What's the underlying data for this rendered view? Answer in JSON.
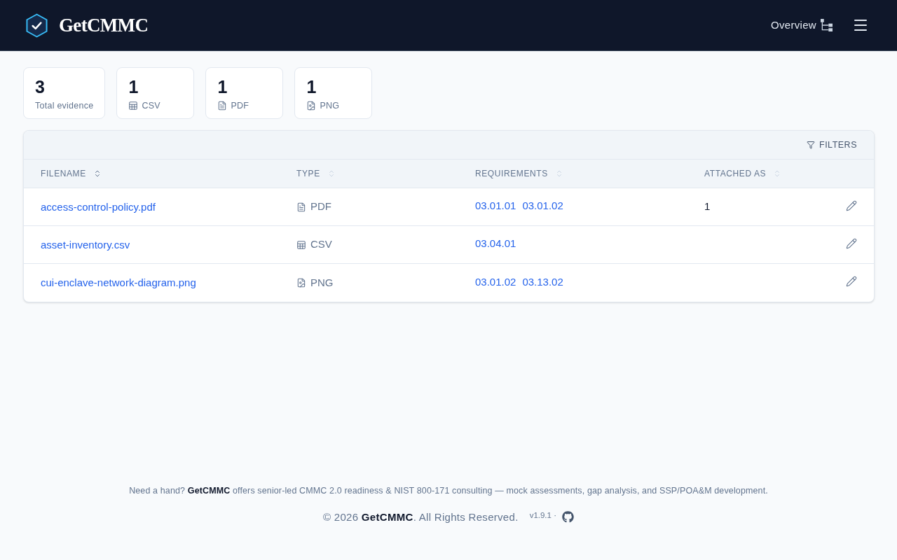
{
  "header": {
    "brand": "GetCMMC",
    "nav_link": "Overview"
  },
  "stats": [
    {
      "value": "3",
      "label": "Total evidence",
      "kind": "total"
    },
    {
      "value": "1",
      "label": "CSV",
      "kind": "csv"
    },
    {
      "value": "1",
      "label": "PDF",
      "kind": "pdf"
    },
    {
      "value": "1",
      "label": "PNG",
      "kind": "png"
    }
  ],
  "table": {
    "filter_button": "FILTERS",
    "columns": [
      {
        "label": "FILENAME",
        "sorted": true
      },
      {
        "label": "TYPE",
        "sorted": false
      },
      {
        "label": "REQUIREMENTS",
        "sorted": false
      },
      {
        "label": "ATTACHED AS",
        "sorted": false
      }
    ],
    "rows": [
      {
        "filename": "access-control-policy.pdf",
        "type": "PDF",
        "kind": "pdf",
        "requirements": [
          "03.01.01",
          "03.01.02"
        ],
        "attached_as": "1"
      },
      {
        "filename": "asset-inventory.csv",
        "type": "CSV",
        "kind": "csv",
        "requirements": [
          "03.04.01"
        ]
      },
      {
        "filename": "cui-enclave-network-diagram.png",
        "type": "PNG",
        "kind": "png",
        "requirements": [
          "03.01.02",
          "03.13.02"
        ]
      }
    ]
  },
  "footer": {
    "note": "Need a hand? **GetCMMC** offers senior-led CMMC 2.0 readiness & NIST 800-171 consulting — mock assessments, gap analysis, and SSP/POA&M development.",
    "copyright": "© 2026 **GetCMMC**. All Rights Reserved.",
    "version": "v1.9.1 ·"
  }
}
